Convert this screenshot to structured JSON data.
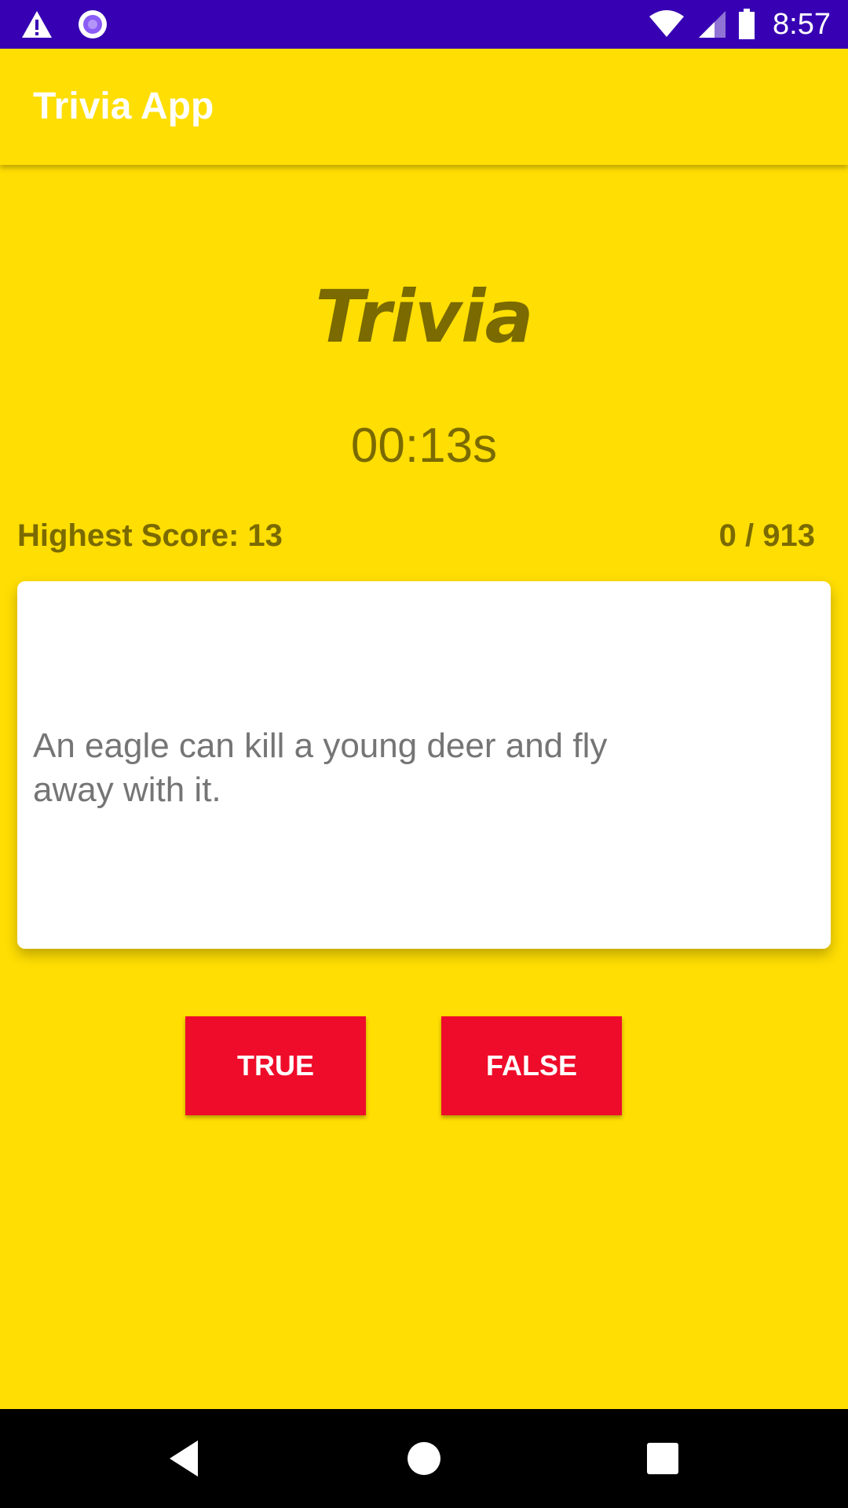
{
  "status_bar": {
    "time": "8:57",
    "icons": [
      "warning-icon",
      "circle-notification-icon",
      "wifi-icon",
      "cellular-signal-icon",
      "battery-icon"
    ],
    "background_color": "#3700B3"
  },
  "app_bar": {
    "title": "Trivia App",
    "background_color": "#FFDE03"
  },
  "main": {
    "headline": "Trivia",
    "timer": "00:13s",
    "highest_score_label": "Highest Score: 13",
    "progress": "0 / 913",
    "question": "An eagle can kill a young deer and fly away with it.",
    "text_color": "#7A6A00"
  },
  "buttons": {
    "true_label": "TRUE",
    "false_label": "FALSE",
    "color": "#EF0C2A"
  },
  "nav_bar": {
    "icons": [
      "back-icon",
      "home-icon",
      "recents-icon"
    ]
  }
}
